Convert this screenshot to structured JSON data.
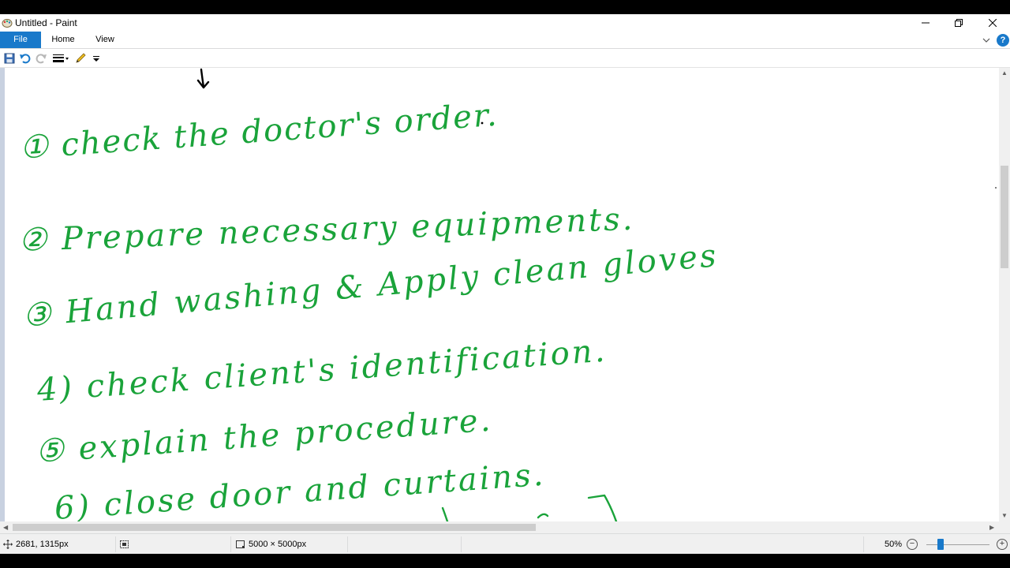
{
  "window": {
    "title": "Untitled - Paint"
  },
  "tabs": {
    "file": "File",
    "home": "Home",
    "view": "View"
  },
  "help": {
    "label": "?"
  },
  "status": {
    "cursor_position": "2681, 1315px",
    "canvas_size": "5000 × 5000px",
    "zoom": "50%",
    "zoom_out": "−",
    "zoom_in": "+"
  },
  "icons": {
    "app": "paint-icon",
    "save": "save-icon",
    "undo": "undo-icon",
    "redo": "redo-icon",
    "line_size": "line-size-icon",
    "pencil": "pencil-icon",
    "customize": "customize-dropdown-icon",
    "cursor": "move-cursor-icon",
    "selection": "selection-size-icon",
    "canvas": "canvas-size-icon"
  },
  "colors": {
    "accent": "#1979ca",
    "ink": "#1aa33a",
    "canvas_bg": "#ffffff",
    "workspace_bg": "#c8d1e0"
  },
  "canvas": {
    "handwritten_lines": [
      "① check the doctor's order.",
      "② Prepare necessary equipments.",
      "③ Hand washing & Apply clean gloves",
      "4) check client's identification.",
      "⑤ explain the procedure.",
      "6) close door and curtains."
    ]
  }
}
